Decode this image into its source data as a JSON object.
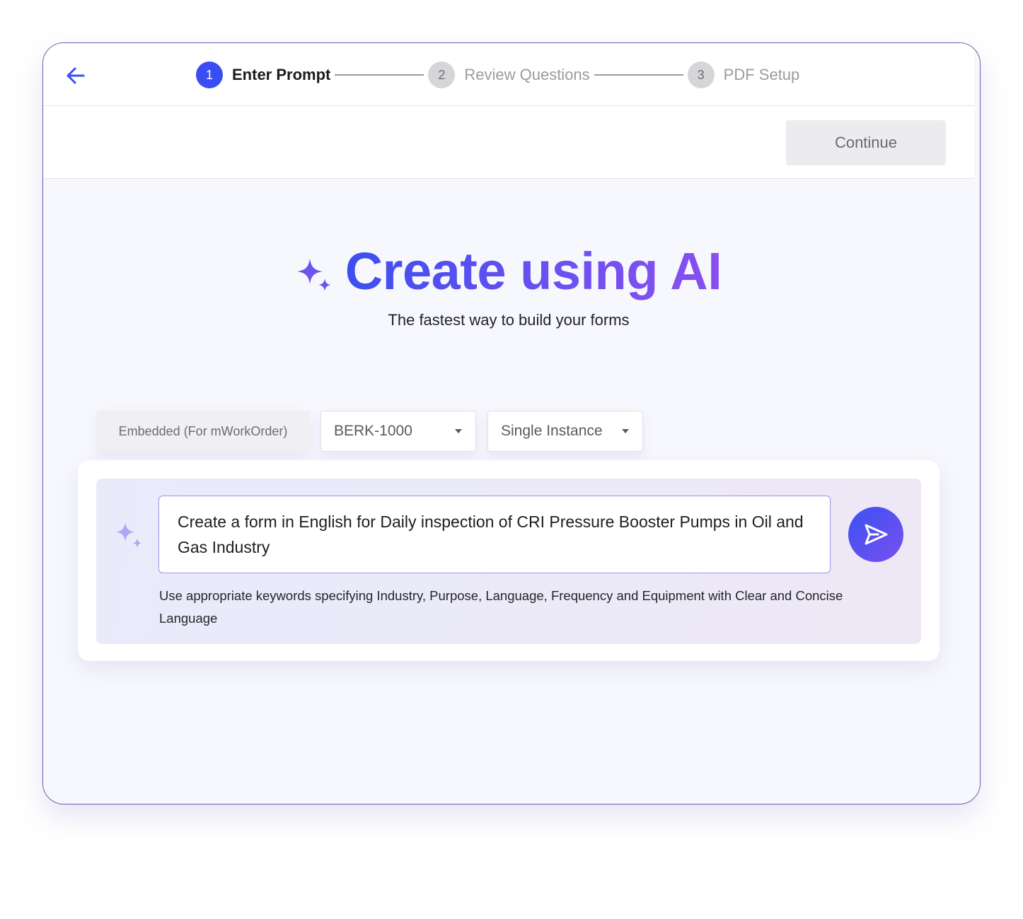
{
  "stepper": {
    "steps": [
      {
        "number": "1",
        "label": "Enter Prompt",
        "state": "active"
      },
      {
        "number": "2",
        "label": "Review Questions",
        "state": "inactive"
      },
      {
        "number": "3",
        "label": "PDF Setup",
        "state": "inactive"
      }
    ]
  },
  "toolbar": {
    "continue_label": "Continue"
  },
  "hero": {
    "title": "Create using AI",
    "subtitle": "The fastest way to build your forms"
  },
  "selectors": {
    "embedded_label": "Embedded (For mWorkOrder)",
    "asset_value": "BERK-1000",
    "instance_value": "Single Instance"
  },
  "prompt": {
    "value": "Create a form in English for Daily inspection of CRI Pressure Booster Pumps in Oil and Gas Industry",
    "hint": "Use appropriate keywords specifying Industry, Purpose, Language, Frequency and Equipment with Clear and Concise Language"
  },
  "icons": {
    "back": "arrow-left-icon",
    "hero": "sparkle-icon",
    "prompt": "sparkle-icon",
    "send": "send-icon",
    "caret": "caret-down-icon"
  },
  "colors": {
    "accent": "#3a4df5",
    "gradient_start": "#3d4ff0",
    "gradient_end": "#8a4ff0",
    "frame_border": "#6b5fa8"
  }
}
